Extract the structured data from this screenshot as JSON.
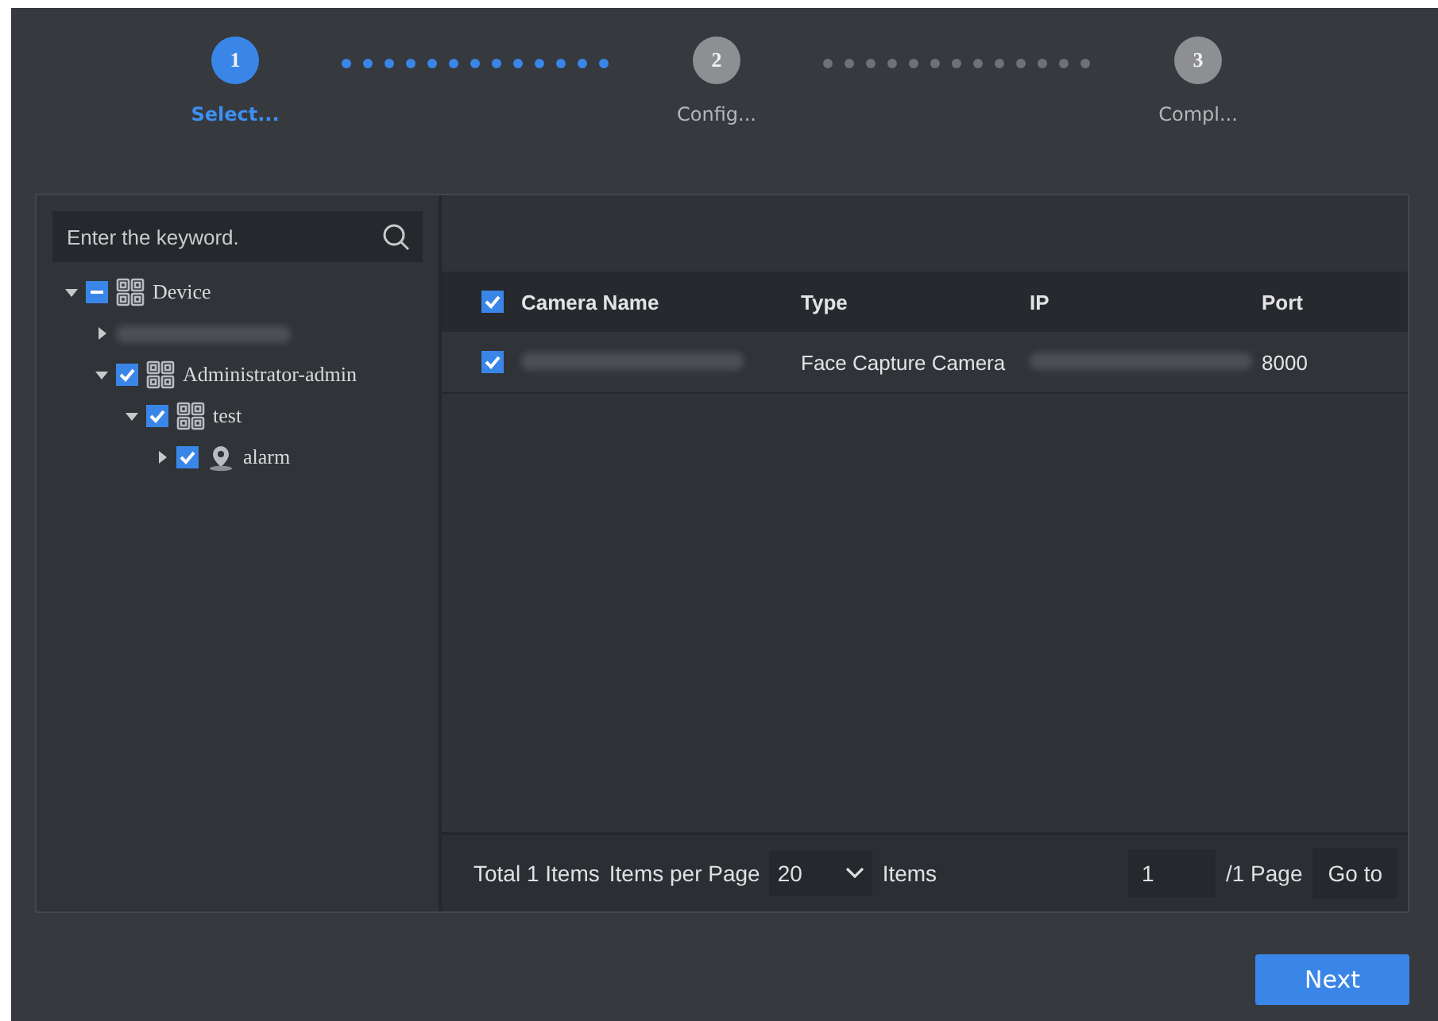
{
  "steps": [
    {
      "number": "1",
      "label": "Select...",
      "selected": true
    },
    {
      "number": "2",
      "label": "Config...",
      "selected": false
    },
    {
      "number": "3",
      "label": "Compl...",
      "selected": false
    }
  ],
  "connectors": [
    {
      "done": true
    },
    {
      "done": false
    }
  ],
  "search": {
    "placeholder": "Enter the keyword."
  },
  "tree": [
    {
      "kind": "group",
      "label": "Device",
      "expanded": true,
      "checked": true,
      "partial": true,
      "children": [
        {
          "kind": "redacted",
          "expanded": false
        },
        {
          "kind": "group",
          "label": "Administrator-admin",
          "expanded": true,
          "checked": true,
          "partial": false,
          "children": [
            {
              "kind": "group",
              "label": "test",
              "expanded": true,
              "checked": true,
              "partial": false,
              "children": [
                {
                  "kind": "camera",
                  "label": "alarm",
                  "expanded": false,
                  "checked": true,
                  "partial": false
                }
              ]
            }
          ]
        }
      ]
    }
  ],
  "table": {
    "all_checked": true,
    "columns": [
      "Camera Name",
      "Type",
      "IP",
      "Port"
    ],
    "rows": [
      {
        "checked": true,
        "cells": [
          {
            "kind": "redacted"
          },
          {
            "kind": "text",
            "text": "Face Capture Camera"
          },
          {
            "kind": "redacted"
          },
          {
            "kind": "text",
            "text": "8000"
          }
        ]
      }
    ]
  },
  "pager": {
    "total": "Total 1 Items",
    "per_page_label": "Items per Page",
    "per_page": "20",
    "items_label": "Items",
    "page": "1",
    "pages": "/1 Page",
    "go": "Go to"
  },
  "buttons": [
    "Next"
  ]
}
